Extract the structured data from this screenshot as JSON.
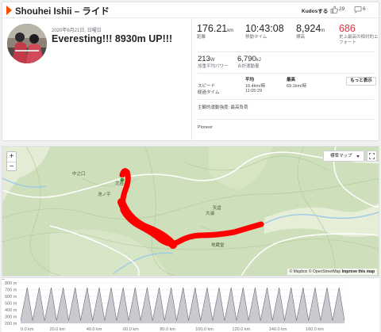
{
  "header": {
    "title": "Shouhei Ishii – ライド",
    "kudos_label": "Kudosする",
    "kudos_count": "29",
    "comment_count": "6"
  },
  "activity": {
    "date": "2020年6月21日, 日曜日",
    "name": "Everesting!!! 8930m UP!!!",
    "device": "Pioneer",
    "perceived_exertion_label": "主観的運動強度: 最高負荷"
  },
  "stats": {
    "distance": {
      "value": "176.21",
      "unit": "km",
      "label": "距離"
    },
    "moving_time": {
      "value": "10:43:08",
      "label": "移動タイム"
    },
    "elevation": {
      "value": "8,924",
      "unit": "m",
      "label": "標高"
    },
    "relative_effort": {
      "value": "686",
      "label": "史上最高の相対的エフォート"
    },
    "weighted_power": {
      "value": "213",
      "unit": "W",
      "label": "加重平均パワー"
    },
    "total_work": {
      "value": "6,790",
      "unit": "kJ",
      "label": "合計運動量"
    }
  },
  "table": {
    "col_avg": "平均",
    "col_max": "最高",
    "row_speed_label": "スピード",
    "row_time_label": "経過タイム",
    "speed_avg": "16.4km/時",
    "speed_max": "69.1km/時",
    "elapsed_avg": "11:05:29",
    "more_button": "もっと表示"
  },
  "map": {
    "zoom_in": "+",
    "zoom_out": "−",
    "map_type": "標準マップ",
    "attribution_mapbox": "© Mapbox",
    "attribution_osm": "© OpenStreetMap",
    "attribution_improve": "Improve this map",
    "places": {
      "p1": "北谷",
      "p2": "大浦",
      "p3": "中之口",
      "p4": "池ノ平",
      "p5": "地蔵堂",
      "p6": "矢倉"
    },
    "route_color": "#ff0000"
  },
  "elevation_chart": {
    "y_ticks": [
      "800 m",
      "700 m",
      "600 m",
      "500 m",
      "400 m",
      "300 m",
      "200 m"
    ],
    "x_ticks": [
      "0.0 km",
      "20.0 km",
      "40.0 km",
      "60.0 km",
      "80.0 km",
      "100.0 km",
      "120.0 km",
      "140.0 km",
      "160.0 km"
    ],
    "cycles": 27,
    "min_m": 240,
    "max_m": 730,
    "fill_color": "#c9c9d0",
    "line_color": "#6d6d78"
  }
}
